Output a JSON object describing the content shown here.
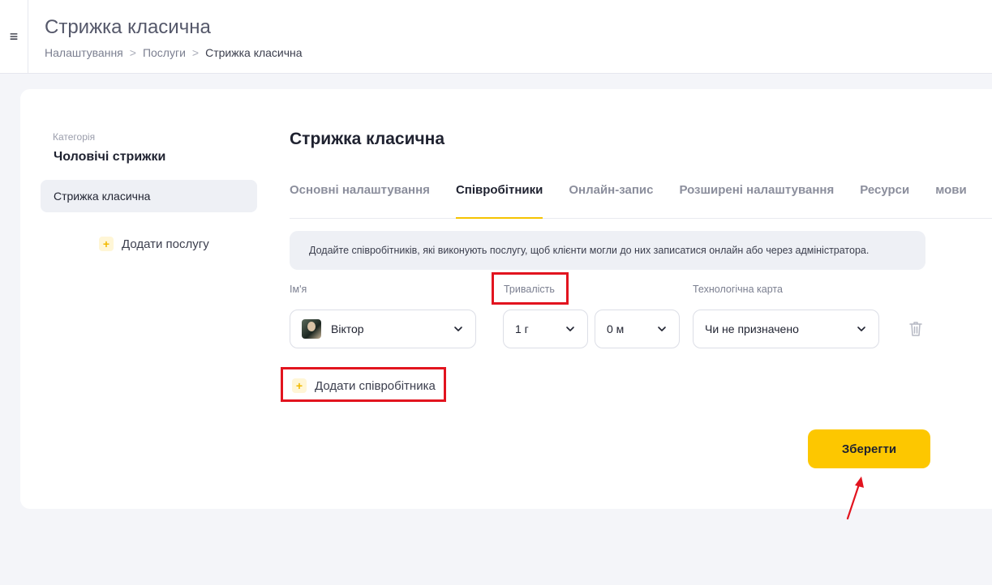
{
  "header": {
    "menu_icon": "≡",
    "title": "Стрижка класична",
    "breadcrumb": [
      "Налаштування",
      "Послуги",
      "Стрижка класична"
    ],
    "breadcrumb_sep": ">"
  },
  "sidebar": {
    "category_label": "Категорія",
    "category_name": "Чоловічі стрижки",
    "services": [
      {
        "label": "Стрижка класична",
        "selected": true
      }
    ],
    "add_service_label": "Додати послугу"
  },
  "main": {
    "title": "Стрижка класична",
    "tabs": [
      {
        "label": "Основні налаштування",
        "active": false
      },
      {
        "label": "Співробітники",
        "active": true
      },
      {
        "label": "Онлайн-запис",
        "active": false
      },
      {
        "label": "Розширені налаштування",
        "active": false
      },
      {
        "label": "Ресурси",
        "active": false
      },
      {
        "label": "мови",
        "active": false
      }
    ],
    "info_text": "Додайте співробітників, які виконують послугу, щоб клієнти могли до них записатися онлайн або через адміністратора.",
    "columns": {
      "name": "Ім'я",
      "duration": "Тривалість",
      "tech_card": "Технологічна карта"
    },
    "employee_row": {
      "name": "Віктор",
      "hours": "1 г",
      "minutes": "0 м",
      "tech_card": "Чи не призначено"
    },
    "add_employee_label": "Додати співробітника",
    "save_label": "Зберегти"
  },
  "colors": {
    "accent": "#fdc700",
    "annotation": "#e2141f"
  }
}
